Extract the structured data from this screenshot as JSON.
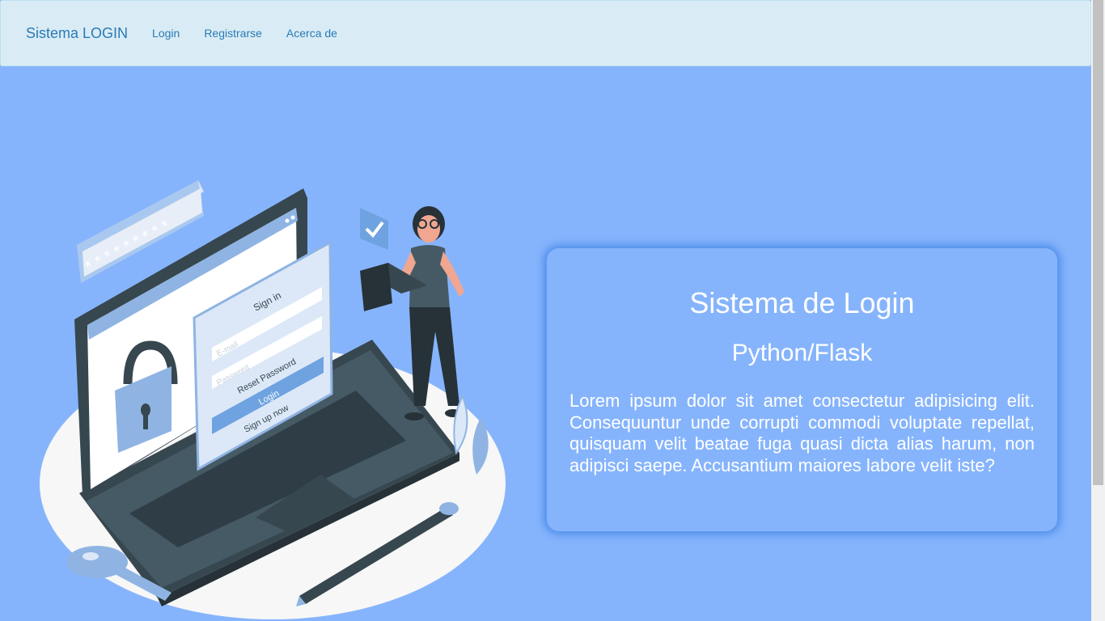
{
  "navbar": {
    "brand": "Sistema LOGIN",
    "links": [
      "Login",
      "Registrarse",
      "Acerca de"
    ]
  },
  "illustration": {
    "password_dots": "* * * * * * * * *",
    "sign_in": "Sign in",
    "email_placeholder": "E-mail",
    "password_placeholder": "Password",
    "reset_password": "Reset Password",
    "login": "Login",
    "sign_up": "Sign up now"
  },
  "card": {
    "title": "Sistema de Login",
    "subtitle": "Python/Flask",
    "body": "Lorem ipsum dolor sit amet consectetur adipisicing elit. Consequuntur unde corrupti commodi voluptate repellat, quisquam velit beatae fuga quasi dicta alias harum, non adipisci saepe. Accusantium maiores labore velit iste?"
  },
  "colors": {
    "background": "#86b4fc",
    "navbar": "#d9ecf5",
    "link": "#2a7ab5",
    "card_text": "#ffffff"
  }
}
